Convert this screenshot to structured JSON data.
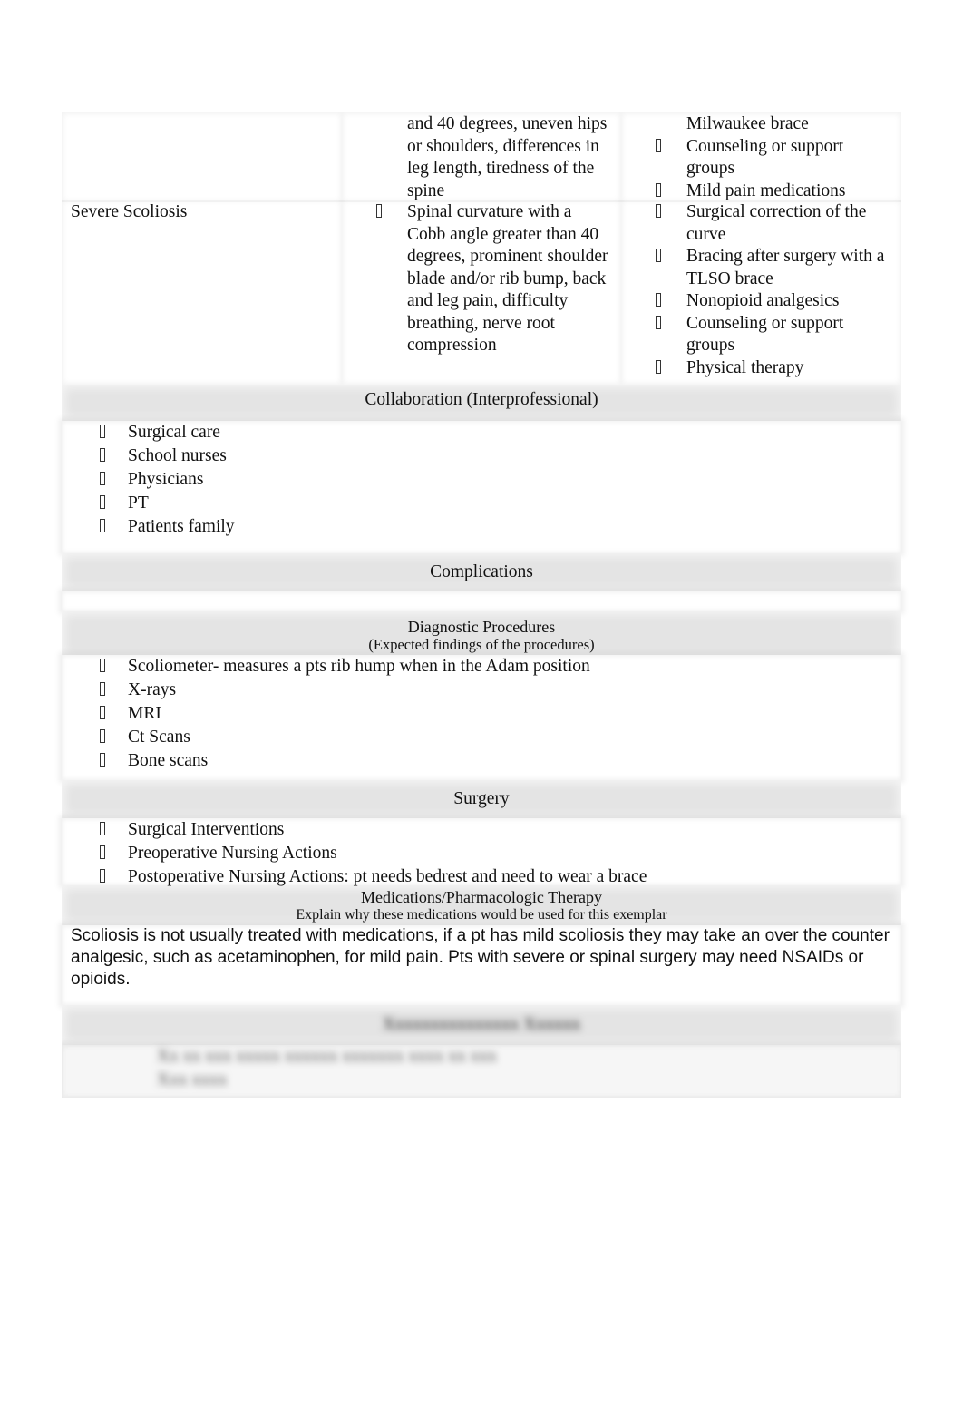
{
  "condition_table": {
    "rows": [
      {
        "stage": "",
        "manifestations": [
          "and 40 degrees, uneven hips or shoulders, differences in leg length, tiredness of the spine"
        ],
        "manifestations_bulleted": false,
        "treatments": [
          {
            "text": "Milwaukee brace",
            "bulleted": false
          },
          {
            "text": "Counseling or support groups",
            "bulleted": true
          },
          {
            "text": "Mild pain medications",
            "bulleted": true
          }
        ]
      },
      {
        "stage": "Severe Scoliosis",
        "manifestations": [
          "Spinal curvature with a Cobb angle greater than 40 degrees, prominent shoulder blade and/or rib bump, back and leg pain, difficulty breathing, nerve root compression"
        ],
        "manifestations_bulleted": true,
        "treatments": [
          {
            "text": "Surgical correction of the curve",
            "bulleted": true
          },
          {
            "text": "Bracing after surgery with a TLSO brace",
            "bulleted": true
          },
          {
            "text": "Nonopioid analgesics",
            "bulleted": true
          },
          {
            "text": "Counseling or support groups",
            "bulleted": true
          },
          {
            "text": "Physical therapy",
            "bulleted": true
          }
        ]
      }
    ]
  },
  "bullet_glyph": "missing-glyph-box",
  "collaboration": {
    "title": "Collaboration (Interprofessional)",
    "items": [
      "Surgical care",
      "School nurses",
      "Physicians",
      "PT",
      "Patients family"
    ]
  },
  "complications": {
    "title": "Complications",
    "items": []
  },
  "diagnostics": {
    "title": "Diagnostic Procedures",
    "subtitle": "(Expected findings of the procedures)",
    "items": [
      "Scoliometer- measures a pts rib hump when in the Adam position",
      "X-rays",
      "MRI",
      "Ct Scans",
      "Bone scans"
    ]
  },
  "surgery": {
    "title": "Surgery",
    "items": [
      "Surgical Interventions",
      "Preoperative Nursing Actions",
      "Postoperative Nursing Actions: pt needs bedrest and need to wear a brace"
    ]
  },
  "medications": {
    "title": "Medications/Pharmacologic Therapy",
    "subtitle": "Explain why these medications would be used for this exemplar",
    "body": "Scoliosis is not usually treated with medications, if a pt has mild scoliosis they may take an over the counter analgesic, such as acetaminophen, for mild pain. Pts with severe or spinal surgery may need NSAIDs or opioids."
  },
  "obscured_section": {
    "note": "blurred preview section - text not legible",
    "title_placeholder": "Xxxxxxxxxxxxxxx Xxxxxx",
    "items_placeholder": [
      "Xx xx xxx xxxxx xxxxxx xxxxxxx xxxx xx xxx",
      "Xxx xxxx"
    ]
  }
}
